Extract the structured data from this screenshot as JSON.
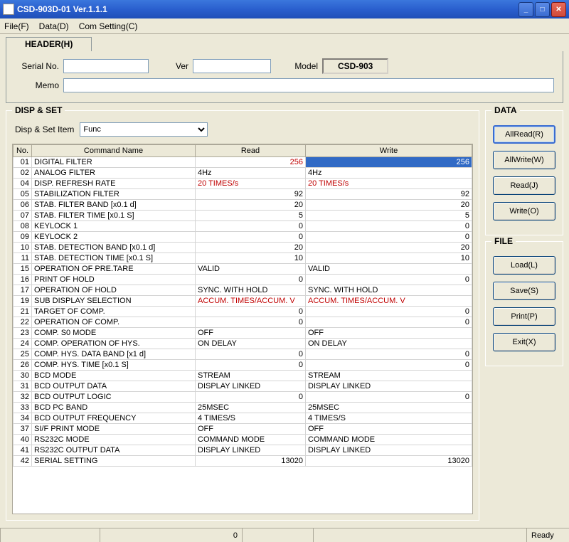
{
  "window": {
    "title": "CSD-903D-01 Ver.1.1.1"
  },
  "menu": {
    "file": "File(F)",
    "data": "Data(D)",
    "com": "Com Setting(C)"
  },
  "header": {
    "tab": "HEADER(H)",
    "serial_lbl": "Serial No.",
    "ver_lbl": "Ver",
    "model_lbl": "Model",
    "model_val": "CSD-903",
    "memo_lbl": "Memo",
    "serial_val": "",
    "ver_val": "",
    "memo_val": ""
  },
  "disp": {
    "title": "DISP & SET",
    "item_lbl": "Disp & Set Item",
    "item_val": "Func",
    "cols": {
      "no": "No.",
      "name": "Command Name",
      "read": "Read",
      "write": "Write"
    }
  },
  "rows": [
    {
      "no": "01",
      "name": "DIGITAL FILTER",
      "read": "256",
      "write": "256",
      "rnum": true,
      "wnum": true,
      "rred": true,
      "sel": true
    },
    {
      "no": "02",
      "name": "ANALOG FILTER",
      "read": "4Hz",
      "write": "4Hz"
    },
    {
      "no": "04",
      "name": "DISP. REFRESH RATE",
      "read": "20 TIMES/s",
      "write": "20 TIMES/s",
      "rred": true,
      "wred": true
    },
    {
      "no": "05",
      "name": "STABILIZATION FILTER",
      "read": "92",
      "write": "92",
      "rnum": true,
      "wnum": true
    },
    {
      "no": "06",
      "name": "STAB. FILTER BAND [x0.1 d]",
      "read": "20",
      "write": "20",
      "rnum": true,
      "wnum": true
    },
    {
      "no": "07",
      "name": "STAB. FILTER TIME [x0.1 S]",
      "read": "5",
      "write": "5",
      "rnum": true,
      "wnum": true
    },
    {
      "no": "08",
      "name": "KEYLOCK 1",
      "read": "0",
      "write": "0",
      "rnum": true,
      "wnum": true
    },
    {
      "no": "09",
      "name": "KEYLOCK 2",
      "read": "0",
      "write": "0",
      "rnum": true,
      "wnum": true
    },
    {
      "no": "10",
      "name": "STAB. DETECTION BAND [x0.1 d]",
      "read": "20",
      "write": "20",
      "rnum": true,
      "wnum": true
    },
    {
      "no": "11",
      "name": "STAB. DETECTION TIME [x0.1 S]",
      "read": "10",
      "write": "10",
      "rnum": true,
      "wnum": true
    },
    {
      "no": "15",
      "name": "OPERATION OF PRE.TARE",
      "read": "VALID",
      "write": "VALID"
    },
    {
      "no": "16",
      "name": "PRINT OF HOLD",
      "read": "0",
      "write": "0",
      "rnum": true,
      "wnum": true
    },
    {
      "no": "17",
      "name": "OPERATION OF HOLD",
      "read": "SYNC. WITH HOLD",
      "write": "SYNC. WITH HOLD"
    },
    {
      "no": "19",
      "name": "SUB DISPLAY SELECTION",
      "read": "ACCUM. TIMES/ACCUM. V",
      "write": "ACCUM. TIMES/ACCUM. V",
      "rred": true,
      "wred": true
    },
    {
      "no": "21",
      "name": "TARGET OF COMP.",
      "read": "0",
      "write": "0",
      "rnum": true,
      "wnum": true
    },
    {
      "no": "22",
      "name": "OPERATION OF COMP.",
      "read": "0",
      "write": "0",
      "rnum": true,
      "wnum": true
    },
    {
      "no": "23",
      "name": "COMP. S0 MODE",
      "read": "OFF",
      "write": "OFF"
    },
    {
      "no": "24",
      "name": "COMP. OPERATION OF HYS.",
      "read": "ON DELAY",
      "write": "ON DELAY"
    },
    {
      "no": "25",
      "name": "COMP. HYS. DATA BAND [x1 d]",
      "read": "0",
      "write": "0",
      "rnum": true,
      "wnum": true
    },
    {
      "no": "26",
      "name": "COMP. HYS. TIME [x0.1 S]",
      "read": "0",
      "write": "0",
      "rnum": true,
      "wnum": true
    },
    {
      "no": "30",
      "name": "BCD MODE",
      "read": "STREAM",
      "write": "STREAM"
    },
    {
      "no": "31",
      "name": "BCD OUTPUT DATA",
      "read": "DISPLAY LINKED",
      "write": "DISPLAY LINKED"
    },
    {
      "no": "32",
      "name": "BCD OUTPUT LOGIC",
      "read": "0",
      "write": "0",
      "rnum": true,
      "wnum": true
    },
    {
      "no": "33",
      "name": "BCD PC BAND",
      "read": "25MSEC",
      "write": "25MSEC"
    },
    {
      "no": "34",
      "name": "BCD OUTPUT FREQUENCY",
      "read": "4 TIMES/S",
      "write": "4 TIMES/S"
    },
    {
      "no": "37",
      "name": "SI/F PRINT MODE",
      "read": "OFF",
      "write": "OFF"
    },
    {
      "no": "40",
      "name": "RS232C MODE",
      "read": "COMMAND MODE",
      "write": "COMMAND MODE"
    },
    {
      "no": "41",
      "name": "RS232C OUTPUT DATA",
      "read": "DISPLAY LINKED",
      "write": "DISPLAY LINKED"
    },
    {
      "no": "42",
      "name": "SERIAL SETTING",
      "read": "13020",
      "write": "13020",
      "rnum": true,
      "wnum": true
    }
  ],
  "side": {
    "data_title": "DATA",
    "file_title": "FILE",
    "allread": "AllRead(R)",
    "allwrite": "AllWrite(W)",
    "read": "Read(J)",
    "write": "Write(O)",
    "load": "Load(L)",
    "save": "Save(S)",
    "print": "Print(P)",
    "exit": "Exit(X)"
  },
  "status": {
    "zero": "0",
    "ready": "Ready"
  }
}
